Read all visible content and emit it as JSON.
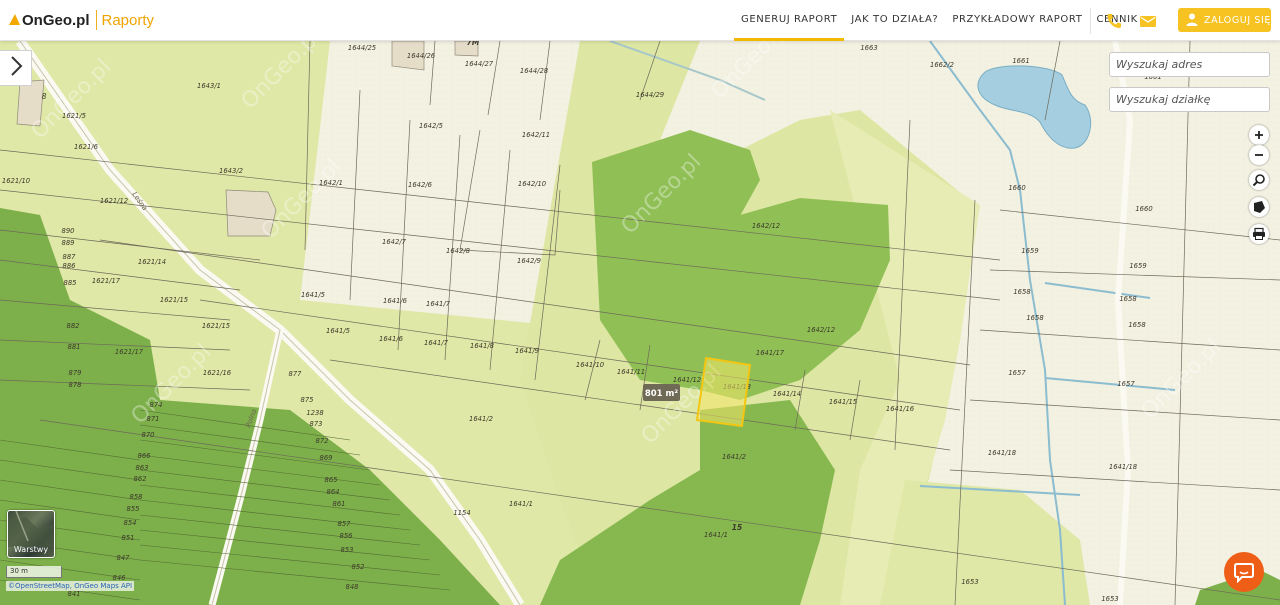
{
  "header": {
    "logo_text": "OnGeo.pl",
    "logo_sub": "Raporty",
    "nav": [
      {
        "label": "GENERUJ RAPORT"
      },
      {
        "label": "JAK TO DZIAŁA?"
      },
      {
        "label": "PRZYKŁADOWY RAPORT"
      },
      {
        "label": "CENNIK"
      }
    ],
    "login_label": "ZALOGUJ SIĘ"
  },
  "search": {
    "address_placeholder": "Wyszukaj adres",
    "parcel_placeholder": "Wyszukaj działkę"
  },
  "map": {
    "selected_area_label": "801 m²",
    "parcel_labels": [
      "1644/25",
      "1644/26",
      "1644/27",
      "1644/28",
      "1644/29",
      "1663",
      "1662/2",
      "1661",
      "1661",
      "1643/1",
      "1642/5",
      "1642/11",
      "1621/5",
      "1621/6",
      "1621/10",
      "1643/2",
      "1642/1",
      "1642/6",
      "1642/10",
      "1621/12",
      "1660",
      "1660",
      "1642/7",
      "1642/8",
      "1642/9",
      "1642/12",
      "1621/14",
      "1621/17",
      "1659",
      "1659",
      "1621/15",
      "1641/5",
      "1641/6",
      "1641/7",
      "1658",
      "1658",
      "1658",
      "1658",
      "1621/15",
      "1641/5",
      "1641/6",
      "1641/7",
      "1641/8",
      "1641/9",
      "1642/12",
      "1621/17",
      "1641/17",
      "1641/10",
      "1641/11",
      "1641/12",
      "1641/13",
      "1621/16",
      "1641/14",
      "1641/15",
      "1641/16",
      "1657",
      "1657",
      "1641/2",
      "1641/2",
      "1641/18",
      "1641/18",
      "1641/1",
      "1641/1",
      "1653",
      "1653",
      "890",
      "889",
      "887",
      "886",
      "885",
      "882",
      "881",
      "879",
      "878",
      "874",
      "871",
      "870",
      "866",
      "863",
      "862",
      "858",
      "855",
      "854",
      "851",
      "847",
      "846",
      "841",
      "877",
      "875",
      "1238",
      "873",
      "872",
      "869",
      "865",
      "864",
      "861",
      "857",
      "856",
      "853",
      "852",
      "848",
      "1154",
      "15",
      "7M",
      "8"
    ],
    "road_labels": [
      "Leśna",
      "Polna"
    ],
    "watermark": "OnGeo.pl",
    "scale_label": "30 m",
    "attribution": "©OpenStreetMap, OnGeo Maps API",
    "layers_label": "Warstwy"
  },
  "colors": {
    "accent": "#f6c323",
    "light_parcel": "#dfe8a6",
    "forest": "#8fbf55",
    "parcel_line": "#6e6a5a",
    "selection": "#f2d21a"
  }
}
